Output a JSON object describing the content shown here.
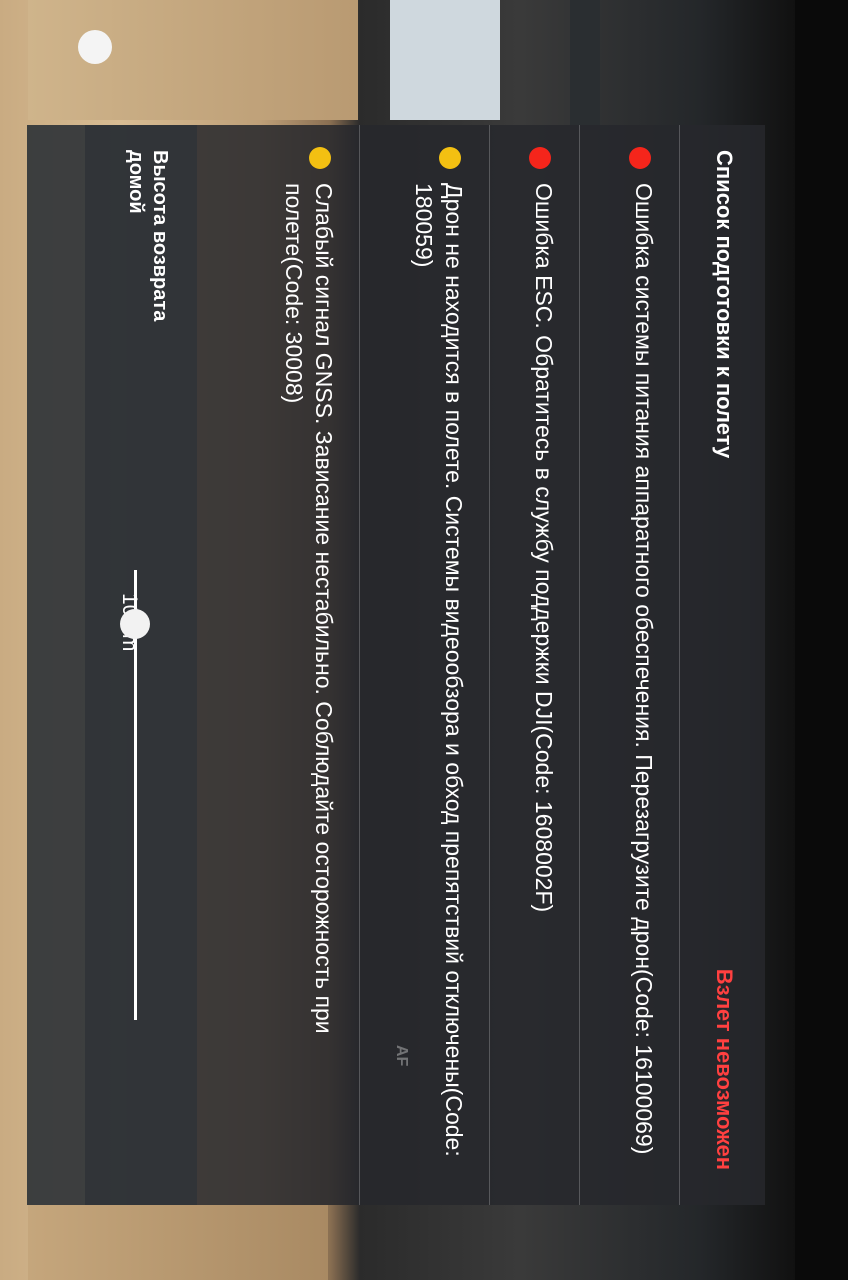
{
  "panel": {
    "title": "Список подготовки к полету",
    "takeoff_status": "Взлет невозможен",
    "status_color": "#ff4040"
  },
  "checklist": [
    {
      "severity": "error",
      "color": "#f5251b",
      "text": "Ошибка системы питания аппаратного обеспечения. Перезагрузите дрон(Code: 16100069)"
    },
    {
      "severity": "error",
      "color": "#f5251b",
      "text": "Ошибка ESC. Обратитесь в службу поддержки DJI(Code: 1608002F)"
    },
    {
      "severity": "warning",
      "color": "#f3c012",
      "text": "Дрон не находится в полете. Системы видеообзора и обход препятствий отключены(Code: 180059)"
    },
    {
      "severity": "warning",
      "color": "#f3c012",
      "text": "Слабый сигнал GNSS. Зависание нестабильно. Соблюдайте осторожность при полете(Code: 30008)"
    }
  ],
  "return_home": {
    "label": "Высота возврата домой",
    "value": "100 m",
    "slider_fraction": 0.12
  },
  "af_label": "AF"
}
